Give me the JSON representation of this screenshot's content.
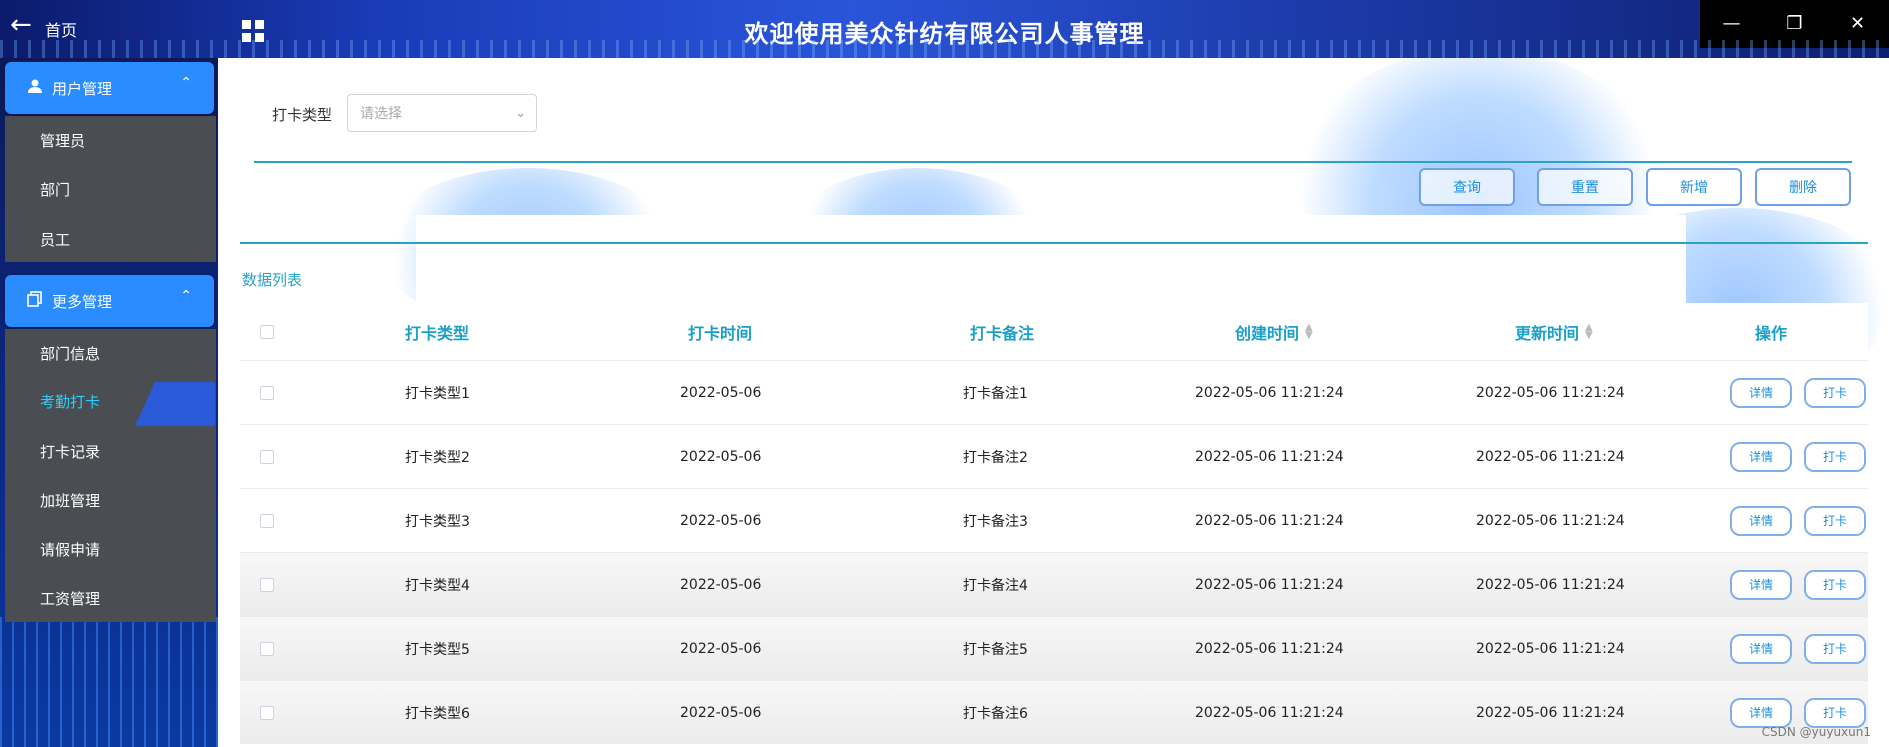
{
  "app": {
    "title": "欢迎使用美众针纺有限公司人事管理",
    "home_label": "首页"
  },
  "sidebar": {
    "groups": [
      {
        "label": "用户管理",
        "items": [
          "管理员",
          "部门",
          "员工"
        ]
      },
      {
        "label": "更多管理",
        "items": [
          "部门信息",
          "考勤打卡",
          "打卡记录",
          "加班管理",
          "请假申请",
          "工资管理"
        ]
      }
    ],
    "active_item": "考勤打卡"
  },
  "filter": {
    "label": "打卡类型",
    "placeholder": "请选择"
  },
  "toolbar": {
    "query": "查询",
    "reset": "重置",
    "add": "新增",
    "delete": "删除"
  },
  "list_title": "数据列表",
  "table": {
    "headers": [
      "打卡类型",
      "打卡时间",
      "打卡备注",
      "创建时间",
      "更新时间",
      "操作"
    ],
    "rows": [
      [
        "打卡类型1",
        "2022-05-06",
        "打卡备注1",
        "2022-05-06 11:21:24",
        "2022-05-06 11:21:24"
      ],
      [
        "打卡类型2",
        "2022-05-06",
        "打卡备注2",
        "2022-05-06 11:21:24",
        "2022-05-06 11:21:24"
      ],
      [
        "打卡类型3",
        "2022-05-06",
        "打卡备注3",
        "2022-05-06 11:21:24",
        "2022-05-06 11:21:24"
      ],
      [
        "打卡类型4",
        "2022-05-06",
        "打卡备注4",
        "2022-05-06 11:21:24",
        "2022-05-06 11:21:24"
      ],
      [
        "打卡类型5",
        "2022-05-06",
        "打卡备注5",
        "2022-05-06 11:21:24",
        "2022-05-06 11:21:24"
      ],
      [
        "打卡类型6",
        "2022-05-06",
        "打卡备注6",
        "2022-05-06 11:21:24",
        "2022-05-06 11:21:24"
      ]
    ],
    "row_actions": [
      "详情",
      "打卡"
    ]
  },
  "watermark": "CSDN @yuyuxun1",
  "colors": {
    "accent": "#29a3c4",
    "menu_header": "#2b8cff",
    "active_text": "#2bd0ff"
  },
  "icons": [
    "back-arrow-icon",
    "grid-icon",
    "user-icon",
    "copy-icon",
    "chevron-up-icon",
    "chevron-down-icon",
    "sort-icon",
    "hand-cursor-icon",
    "minimize-icon",
    "restore-icon",
    "close-icon"
  ]
}
